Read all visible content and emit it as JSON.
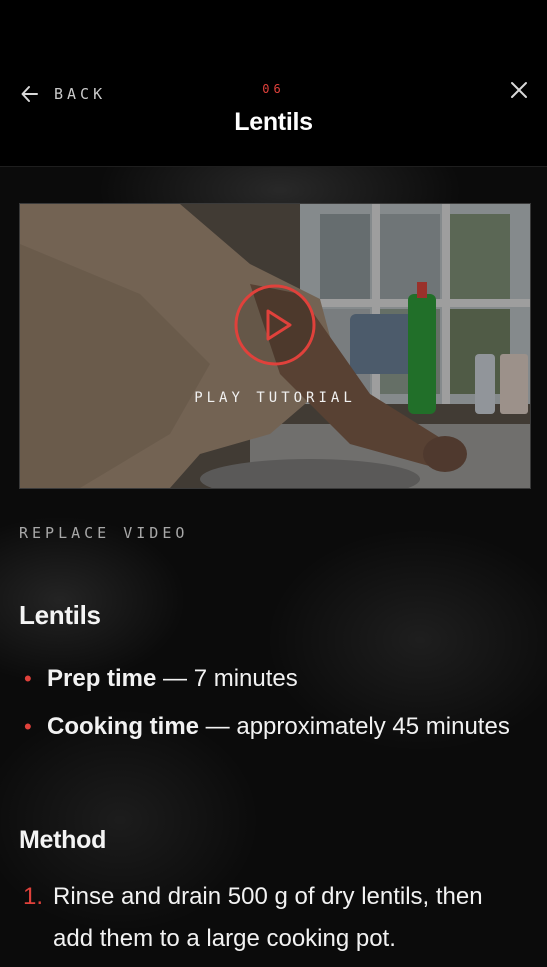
{
  "header": {
    "back_label": "BACK",
    "step_number": "06",
    "title": "Lentils"
  },
  "video": {
    "play_label": "PLAY TUTORIAL",
    "replace_label": "REPLACE VIDEO"
  },
  "recipe": {
    "heading": "Lentils",
    "facts": [
      {
        "key": "Prep time",
        "value": " — 7 minutes"
      },
      {
        "key": "Cooking time",
        "value": " — approximately 45 minutes"
      }
    ],
    "method_heading": "Method",
    "steps": [
      {
        "num": "1.",
        "text": "Rinse and drain 500 g of dry lentils, then add them to a large cooking pot."
      }
    ]
  },
  "colors": {
    "accent": "#e0413b",
    "background": "#0b0b0b"
  },
  "icons": {
    "back": "arrow-left-icon",
    "close": "close-icon",
    "play": "play-icon"
  }
}
